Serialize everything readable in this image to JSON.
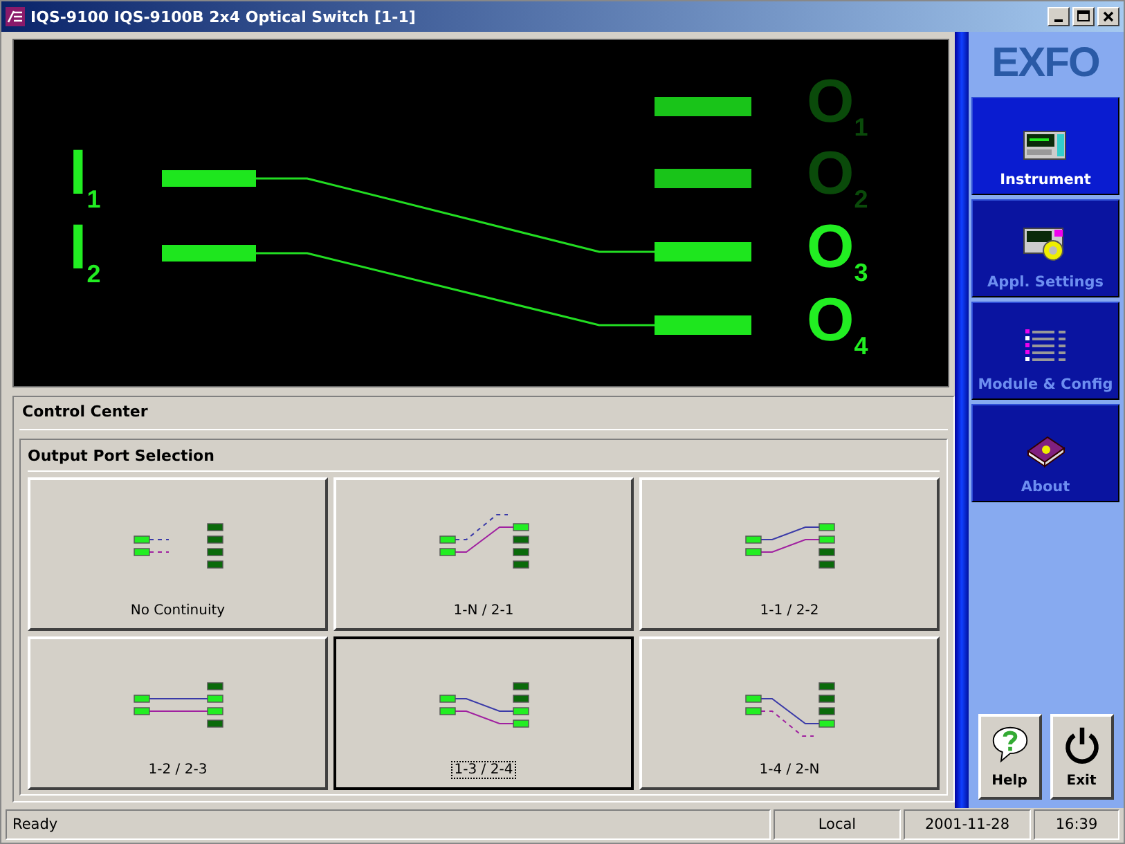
{
  "window": {
    "title": "IQS-9100 IQS-9100B 2x4 Optical Switch [1-1]"
  },
  "display": {
    "inputs": [
      {
        "label": "I$_{1}$"
      },
      {
        "label": "I$_{2}$"
      }
    ],
    "outputs": [
      {
        "label": "O$_{1}$",
        "active": false
      },
      {
        "label": "O$_{2}$",
        "active": false
      },
      {
        "label": "O$_{3}$",
        "active": true
      },
      {
        "label": "O$_{4}$",
        "active": true
      }
    ]
  },
  "control_center": {
    "title": "Control Center",
    "group_title": "Output Port Selection",
    "options": [
      {
        "label": "No Continuity",
        "selected": false,
        "kind": "open"
      },
      {
        "label": "1-N / 2-1",
        "selected": false,
        "kind": "n1"
      },
      {
        "label": "1-1 / 2-2",
        "selected": false,
        "kind": "a12"
      },
      {
        "label": "1-2 / 2-3",
        "selected": false,
        "kind": "a23"
      },
      {
        "label": "1-3 / 2-4",
        "selected": true,
        "kind": "a34"
      },
      {
        "label": "1-4 / 2-N",
        "selected": false,
        "kind": "a4n"
      }
    ]
  },
  "sidebar": {
    "logo": "EXFO",
    "items": [
      {
        "label": "Instrument",
        "selected": true
      },
      {
        "label": "Appl. Settings",
        "selected": false
      },
      {
        "label": "Module & Config",
        "selected": false
      },
      {
        "label": "About",
        "selected": false
      }
    ],
    "buttons": [
      {
        "label": "Help"
      },
      {
        "label": "Exit"
      }
    ]
  },
  "status_bar": [
    "Ready",
    "Local",
    "2001-11-28",
    "16:39"
  ]
}
